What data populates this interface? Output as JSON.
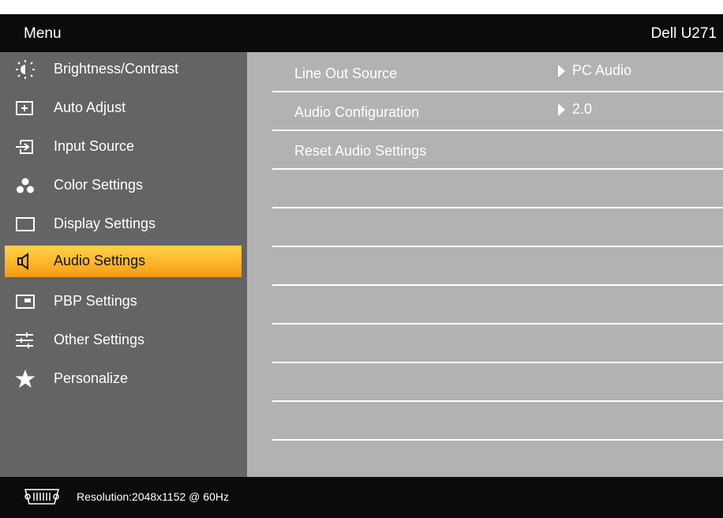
{
  "header": {
    "menu_title": "Menu",
    "model": "Dell U271"
  },
  "sidebar": {
    "items": [
      {
        "label": "Brightness/Contrast",
        "icon": "brightness-icon"
      },
      {
        "label": "Auto Adjust",
        "icon": "auto-adjust-icon"
      },
      {
        "label": "Input Source",
        "icon": "input-source-icon"
      },
      {
        "label": "Color Settings",
        "icon": "color-settings-icon"
      },
      {
        "label": "Display Settings",
        "icon": "display-settings-icon"
      },
      {
        "label": "Audio Settings",
        "icon": "speaker-icon",
        "selected": true
      },
      {
        "label": "PBP Settings",
        "icon": "pbp-icon"
      },
      {
        "label": "Other Settings",
        "icon": "sliders-icon"
      },
      {
        "label": "Personalize",
        "icon": "star-icon"
      }
    ]
  },
  "panel": {
    "rows": [
      {
        "label": "Line Out Source",
        "value": "PC Audio"
      },
      {
        "label": "Audio Configuration",
        "value": "2.0"
      },
      {
        "label": "Reset Audio Settings",
        "value": ""
      }
    ]
  },
  "status": {
    "connector_icon": "vga-connector-icon",
    "resolution": "Resolution:2048x1152 @ 60Hz"
  },
  "colors": {
    "top_bar": "#0b0b0b",
    "sidebar": "#646464",
    "content": "#b2b2b2",
    "highlight": "#ffb52a"
  }
}
